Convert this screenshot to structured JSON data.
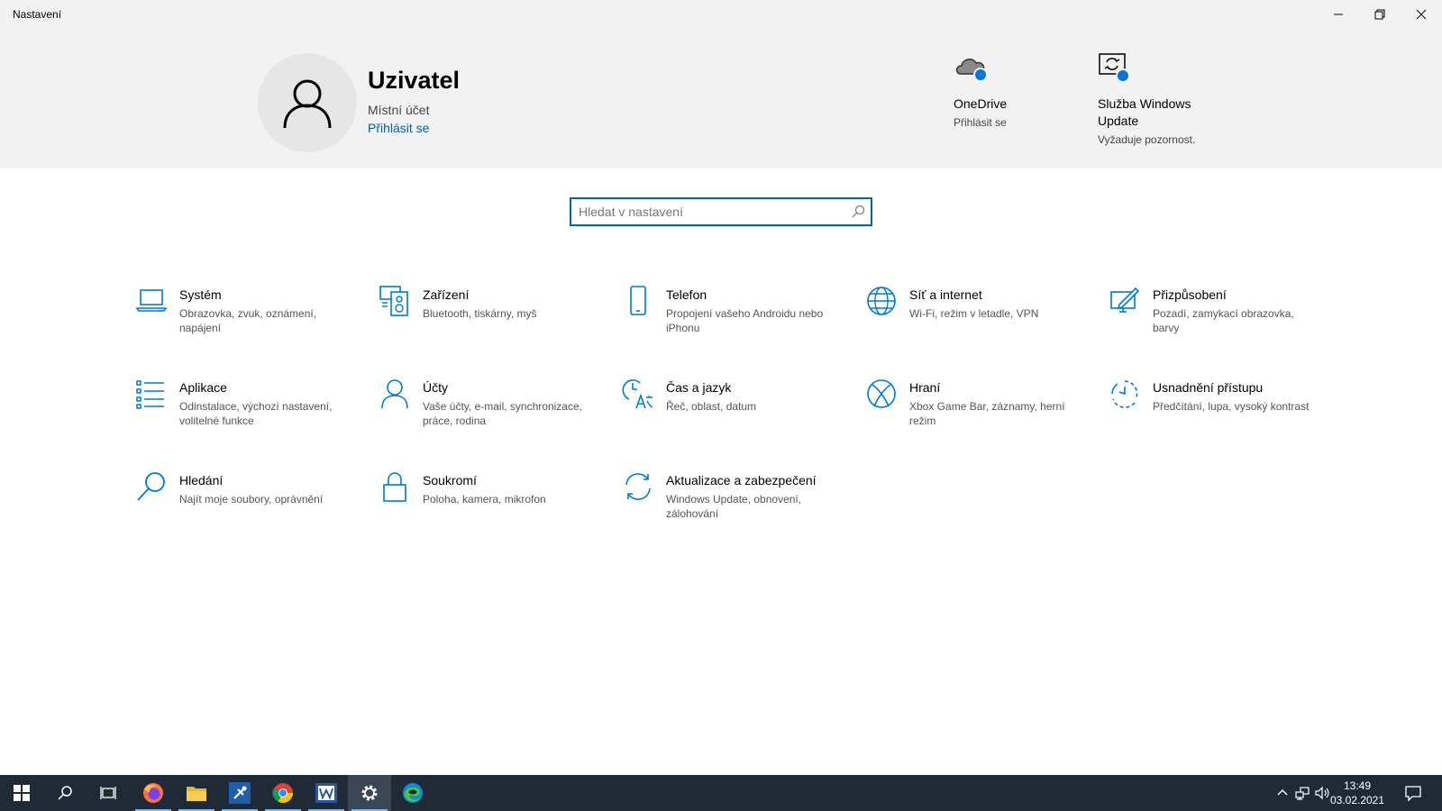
{
  "window": {
    "title": "Nastavení"
  },
  "account": {
    "name": "Uzivatel",
    "type": "Místní účet",
    "signin": "Přihlásit se"
  },
  "header_tiles": [
    {
      "title": "OneDrive",
      "status": "Přihlásit se",
      "icon": "onedrive-cloud-icon"
    },
    {
      "title": "Služba Windows Update",
      "status": "Vyžaduje pozornost.",
      "icon": "windows-update-icon"
    }
  ],
  "search": {
    "placeholder": "Hledat v nastavení",
    "value": ""
  },
  "categories": [
    {
      "title": "Systém",
      "desc": "Obrazovka, zvuk, oznámení, napájení",
      "icon": "laptop-icon"
    },
    {
      "title": "Zařízení",
      "desc": "Bluetooth, tiskárny, myš",
      "icon": "devices-icon"
    },
    {
      "title": "Telefon",
      "desc": "Propojení vašeho Androidu nebo iPhonu",
      "icon": "phone-icon"
    },
    {
      "title": "Síť a internet",
      "desc": "Wi-Fi, režim v letadle, VPN",
      "icon": "globe-icon"
    },
    {
      "title": "Přizpůsobení",
      "desc": "Pozadí, zamykací obrazovka, barvy",
      "icon": "personalization-icon"
    },
    {
      "title": "Aplikace",
      "desc": "Odinstalace, výchozí nastavení, volitelné funkce",
      "icon": "apps-list-icon"
    },
    {
      "title": "Účty",
      "desc": "Vaše účty, e-mail, synchronizace, práce, rodina",
      "icon": "person-icon"
    },
    {
      "title": "Čas a jazyk",
      "desc": "Řeč, oblast, datum",
      "icon": "time-language-icon"
    },
    {
      "title": "Hraní",
      "desc": "Xbox Game Bar, záznamy, herní režim",
      "icon": "xbox-icon"
    },
    {
      "title": "Usnadnění přístupu",
      "desc": "Předčítání, lupa, vysoký kontrast",
      "icon": "ease-of-access-icon"
    },
    {
      "title": "Hledání",
      "desc": "Najít moje soubory, oprávnění",
      "icon": "search-icon"
    },
    {
      "title": "Soukromí",
      "desc": "Poloha, kamera, mikrofon",
      "icon": "lock-icon"
    },
    {
      "title": "Aktualizace a zabezpečení",
      "desc": "Windows Update, obnovení, zálohování",
      "icon": "sync-icon"
    }
  ],
  "taskbar": {
    "apps": [
      "start-icon",
      "search-icon",
      "task-view-icon",
      "firefox-icon",
      "file-explorer-icon",
      "app-icon",
      "chrome-icon",
      "word-icon",
      "settings-icon",
      "edge-icon"
    ],
    "time": "13:49",
    "date": "03.02.2021"
  },
  "colors": {
    "accent": "#0063b1",
    "icon_blue": "#0078d7",
    "header_bg": "#f2f2f2",
    "taskbar_bg": "#1f2a36"
  }
}
